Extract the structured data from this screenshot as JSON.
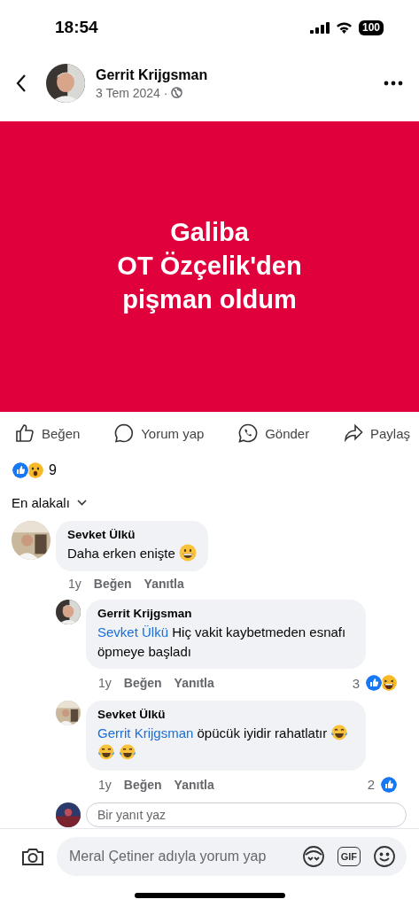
{
  "status_bar": {
    "time": "18:54",
    "battery": "100"
  },
  "post": {
    "author": "Gerrit Krijgsman",
    "date": "3 Tem 2024 ·",
    "avatar": {
      "kind": "picture"
    },
    "banner_lines": [
      "Galiba",
      "OT Özçelik'den",
      "pişman oldum"
    ]
  },
  "actions": [
    {
      "kind": "like",
      "label": "Beğen"
    },
    {
      "kind": "comment",
      "label": "Yorum yap"
    },
    {
      "kind": "whatsapp",
      "label": "Gönder"
    },
    {
      "kind": "share",
      "label": "Paylaş"
    }
  ],
  "reaction_summary": {
    "reactions": [
      {
        "kind": "like"
      },
      {
        "kind": "wow"
      }
    ],
    "count": "9"
  },
  "sort": {
    "label": "En alakalı"
  },
  "comments": [
    {
      "author": "Sevket Ülkü",
      "text": "Daha erken enişte",
      "emojis": [
        {
          "kind": "grin"
        }
      ],
      "time": "1y",
      "like_label": "Beğen",
      "reply_label": "Yanıtla",
      "replies": [
        {
          "author": "Gerrit Krijgsman",
          "mention": "Sevket Ülkü",
          "text": "Hiç vakit kaybetmeden esnafı öpmeye başladı",
          "time": "1y",
          "like_label": "Beğen",
          "reply_label": "Yanıtla",
          "reaction_count": "3",
          "reactions": [
            {
              "kind": "like"
            },
            {
              "kind": "haha"
            }
          ]
        },
        {
          "author": "Sevket Ülkü",
          "mention": "Gerrit Krijgsman",
          "text": "öpücük iyidir rahatlatır",
          "emojis": [
            {
              "kind": "tears"
            },
            {
              "kind": "tears"
            },
            {
              "kind": "tears"
            }
          ],
          "time": "1y",
          "like_label": "Beğen",
          "reply_label": "Yanıtla",
          "reaction_count": "2",
          "reactions": [
            {
              "kind": "like"
            }
          ]
        }
      ]
    }
  ],
  "reply_field": {
    "placeholder": "Bir yanıt yaz"
  },
  "composer": {
    "placeholder": "Meral Çetiner adıyla yorum yap",
    "gif_label": "GIF"
  }
}
